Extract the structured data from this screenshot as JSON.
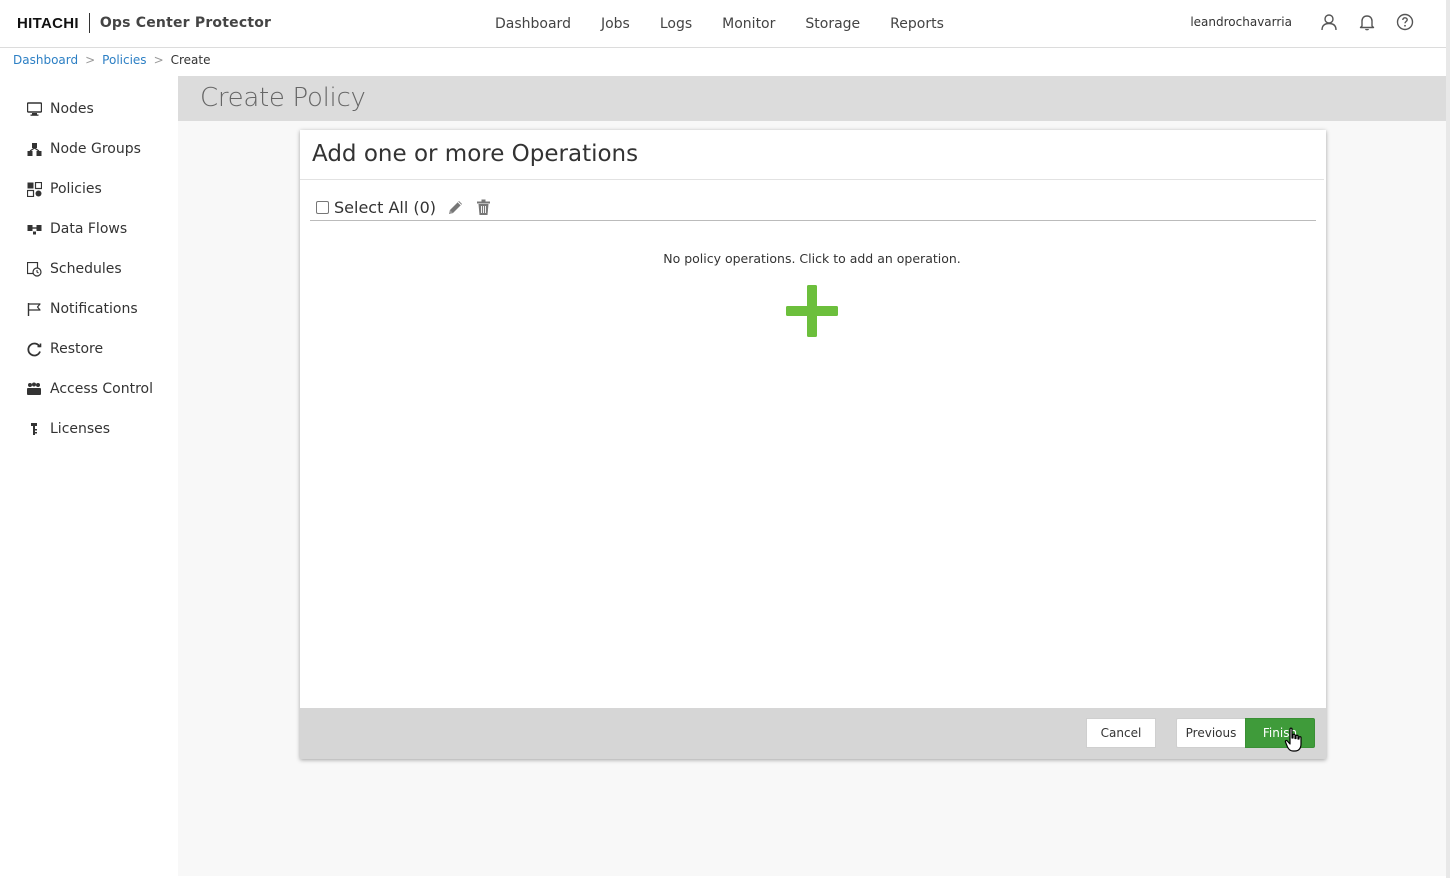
{
  "header": {
    "brand_logo": "HITACHI",
    "product_name": "Ops Center Protector",
    "nav": [
      "Dashboard",
      "Jobs",
      "Logs",
      "Monitor",
      "Storage",
      "Reports"
    ],
    "username": "leandrochavarria",
    "icons": [
      "user-icon",
      "bell-icon",
      "help-icon"
    ]
  },
  "breadcrumb": {
    "items": [
      "Dashboard",
      "Policies"
    ],
    "separator": ">",
    "current": "Create"
  },
  "sidebar": {
    "items": [
      {
        "label": "Nodes",
        "icon": "monitor-icon"
      },
      {
        "label": "Node Groups",
        "icon": "node-groups-icon"
      },
      {
        "label": "Policies",
        "icon": "policies-icon"
      },
      {
        "label": "Data Flows",
        "icon": "data-flows-icon"
      },
      {
        "label": "Schedules",
        "icon": "schedules-icon"
      },
      {
        "label": "Notifications",
        "icon": "flag-icon"
      },
      {
        "label": "Restore",
        "icon": "restore-icon"
      },
      {
        "label": "Access Control",
        "icon": "access-control-icon"
      },
      {
        "label": "Licenses",
        "icon": "license-icon"
      }
    ]
  },
  "page": {
    "title": "Create Policy"
  },
  "wizard": {
    "step_title": "Add one or more Operations",
    "select_all_label": "Select All (0)",
    "empty_message": "No policy operations. Click to add an operation.",
    "buttons": {
      "cancel": "Cancel",
      "previous": "Previous",
      "finish": "Finish"
    }
  },
  "colors": {
    "accent_green": "#6cbf3c",
    "finish_green": "#3f9b3a",
    "link_blue": "#2c7fc4",
    "page_header_gray": "#dcdcdc"
  }
}
